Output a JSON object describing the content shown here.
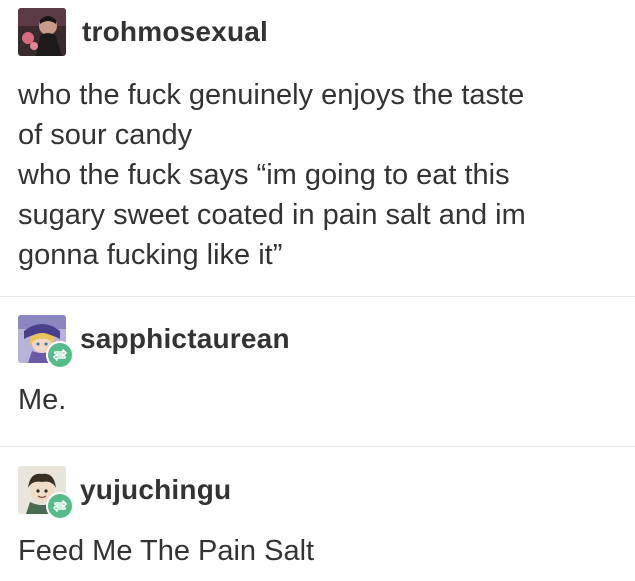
{
  "posts": [
    {
      "username": "trohmosexual",
      "reblog": false,
      "lines": [
        "who the fuck genuinely enjoys the taste",
        "of sour candy",
        "who the fuck says “im going to eat this",
        "sugary sweet coated in pain salt and im",
        "gonna fucking like it”"
      ],
      "avatar_icon": "dark-figure-avatar-icon"
    },
    {
      "username": "sapphictaurean",
      "reblog": true,
      "lines": [
        "Me."
      ],
      "avatar_icon": "anime-girl-avatar-icon"
    },
    {
      "username": "yujuchingu",
      "reblog": true,
      "lines": [
        "Feed Me The Pain Salt"
      ],
      "avatar_icon": "cartoon-boy-avatar-icon"
    }
  ],
  "colors": {
    "reblog_badge": "#56bc8a",
    "divider": "#e6e6e6",
    "text": "#333333"
  }
}
